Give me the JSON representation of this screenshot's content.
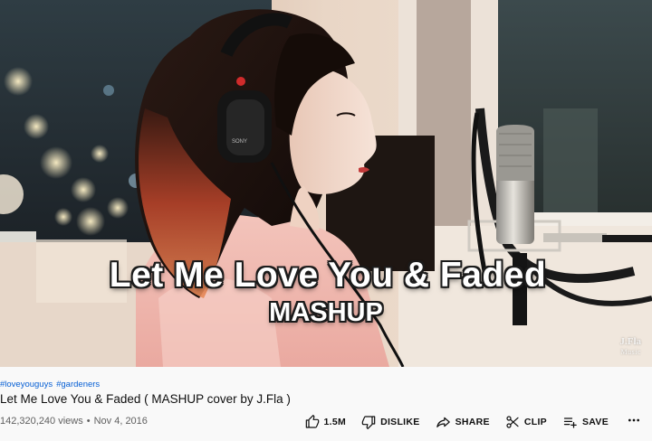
{
  "video": {
    "overlay_line1": "Let Me Love You & Faded",
    "overlay_line2": "MASHUP",
    "watermark_line1": "J.Fla",
    "watermark_line2": "Music",
    "headphone_brand": "SONY"
  },
  "meta": {
    "hashtags": [
      "#loveyouguys",
      "#gardeners"
    ],
    "title": "Let Me Love You & Faded ( MASHUP cover by J.Fla )",
    "views": "142,320,240 views",
    "separator": "•",
    "date": "Nov 4, 2016"
  },
  "actions": {
    "like_label": "1.5M",
    "dislike_label": "DISLIKE",
    "share_label": "SHARE",
    "clip_label": "CLIP",
    "save_label": "SAVE",
    "like_icon": "thumbs-up-icon",
    "dislike_icon": "thumbs-down-icon",
    "share_icon": "share-arrow-icon",
    "clip_icon": "scissors-icon",
    "save_icon": "playlist-add-icon",
    "more_icon": "more-horizontal-icon"
  },
  "colors": {
    "background": "#f9f9f9",
    "hashtag_link": "#065fd4",
    "text_primary": "#0f0f0f",
    "text_secondary": "#606060"
  }
}
